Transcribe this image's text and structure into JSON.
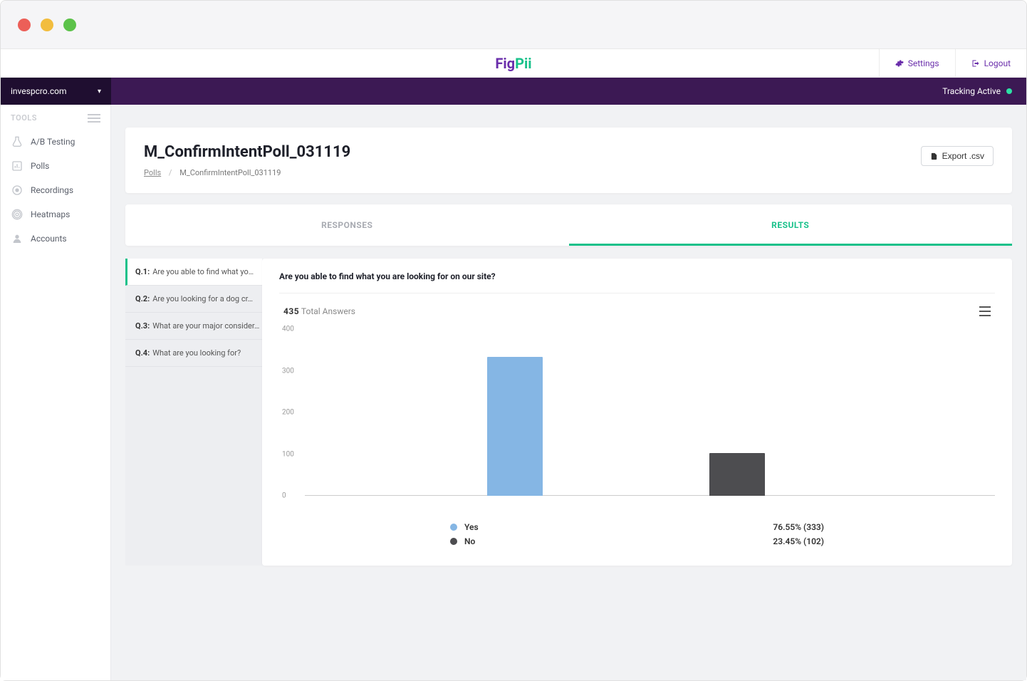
{
  "header": {
    "settings": "Settings",
    "logout": "Logout"
  },
  "sitebar": {
    "site": "invespcro.com",
    "tracking": "Tracking Active"
  },
  "sidebar": {
    "title": "TOOLS",
    "items": [
      {
        "label": "A/B Testing"
      },
      {
        "label": "Polls"
      },
      {
        "label": "Recordings"
      },
      {
        "label": "Heatmaps"
      },
      {
        "label": "Accounts"
      }
    ]
  },
  "page": {
    "title": "M_ConfirmIntentPoll_031119",
    "breadcrumb": {
      "root": "Polls",
      "current": "M_ConfirmIntentPoll_031119"
    },
    "export_label": "Export .csv"
  },
  "tabs": {
    "responses": "RESPONSES",
    "results": "RESULTS"
  },
  "questions": [
    {
      "num": "Q.1:",
      "label": "Are you able to find what yo…"
    },
    {
      "num": "Q.2:",
      "label": "Are you looking for a dog cr…"
    },
    {
      "num": "Q.3:",
      "label": "What are your major consider…"
    },
    {
      "num": "Q.4:",
      "label": "What are you looking for?"
    }
  ],
  "chart": {
    "question": "Are you able to find what you are looking for on our site?",
    "total_answers_num": "435",
    "total_answers_label": "Total Answers",
    "legend": [
      {
        "label": "Yes",
        "value": "76.55% (333)"
      },
      {
        "label": "No",
        "value": "23.45% (102)"
      }
    ]
  },
  "chart_data": {
    "type": "bar",
    "title": "Are you able to find what you are looking for on our site?",
    "categories": [
      "Yes",
      "No"
    ],
    "values": [
      333,
      102
    ],
    "percentages": [
      76.55,
      23.45
    ],
    "ylim": [
      0,
      400
    ],
    "yticks": [
      0,
      100,
      200,
      300,
      400
    ],
    "total": 435,
    "colors": [
      "#85b6e4",
      "#4d4d50"
    ]
  }
}
